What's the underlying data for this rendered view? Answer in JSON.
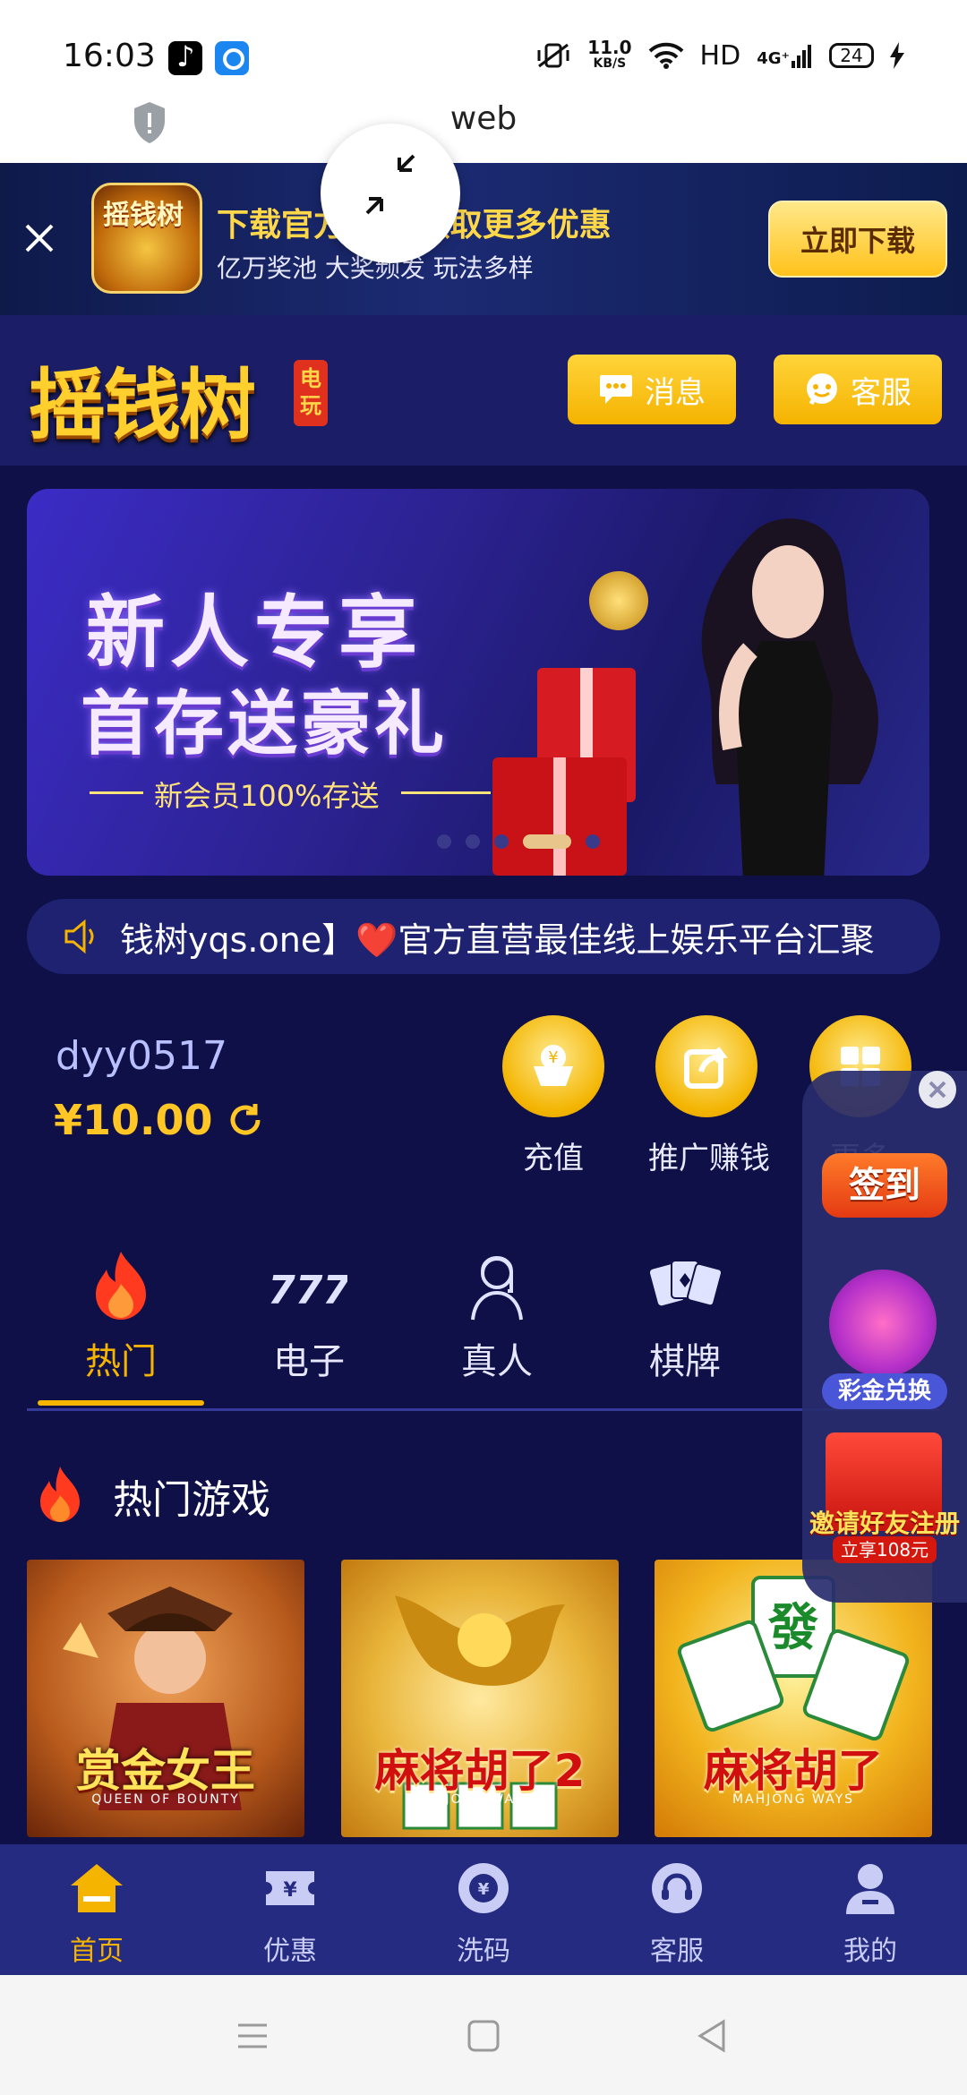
{
  "status_bar": {
    "time": "16:03",
    "network_speed": "11.0",
    "network_speed_unit": "KB/S",
    "hd": "HD",
    "signal": "4G⁺",
    "battery": "24"
  },
  "browser": {
    "site_title": "web",
    "icons": [
      "shield-icon"
    ]
  },
  "download_banner": {
    "title": "下载官方APP领取更多优惠",
    "subtitle": "亿万奖池 大奖频发 玩法多样",
    "button_label": "立即下载",
    "logo_text": "摇钱树"
  },
  "header": {
    "logo": "摇钱树",
    "logo_badge": "电玩",
    "message_label": "消息",
    "service_label": "客服"
  },
  "promo_banner": {
    "title_line1": "新人专享",
    "title_line2": "首存送豪礼",
    "subtitle": "新会员100%存送",
    "slide_count": 5,
    "active_slide": 4
  },
  "marquee": {
    "text": "钱树yqs.one】❤️官方直营最佳线上娱乐平台汇聚"
  },
  "user": {
    "username": "dyy0517",
    "balance": "¥10.00"
  },
  "quick_actions": [
    {
      "label": "充值",
      "icon": "deposit-icon"
    },
    {
      "label": "推广赚钱",
      "icon": "share-icon"
    },
    {
      "label": "更多",
      "icon": "grid-icon"
    }
  ],
  "category_tabs": [
    {
      "label": "热门",
      "icon": "fire-icon",
      "active": true
    },
    {
      "label": "电子",
      "icon": "slot-777-icon",
      "active": false
    },
    {
      "label": "真人",
      "icon": "dealer-icon",
      "active": false
    },
    {
      "label": "棋牌",
      "icon": "cards-icon",
      "active": false
    }
  ],
  "hot_games": {
    "heading": "热门游戏",
    "games": [
      {
        "title": "赏金女王",
        "subtitle": "QUEEN OF BOUNTY"
      },
      {
        "title": "麻将胡了2",
        "subtitle": "MAHJONG WAYS 2"
      },
      {
        "title": "麻将胡了",
        "subtitle": "MAHJONG WAYS"
      }
    ]
  },
  "floating_panel": {
    "sign_in": "签到",
    "exchange": "彩金兑换",
    "invite": "邀请好友注册",
    "invite_reward": "立享108元"
  },
  "bottom_nav": [
    {
      "label": "首页",
      "icon": "home-icon",
      "active": true
    },
    {
      "label": "优惠",
      "icon": "coupon-icon",
      "active": false
    },
    {
      "label": "洗码",
      "icon": "chip-icon",
      "active": false
    },
    {
      "label": "客服",
      "icon": "headset-icon",
      "active": false
    },
    {
      "label": "我的",
      "icon": "user-icon",
      "active": false
    }
  ],
  "colors": {
    "background": "#0f1048",
    "accent": "#f5b400",
    "header": "#1b1e66",
    "bottom_bar": "#262b82"
  }
}
